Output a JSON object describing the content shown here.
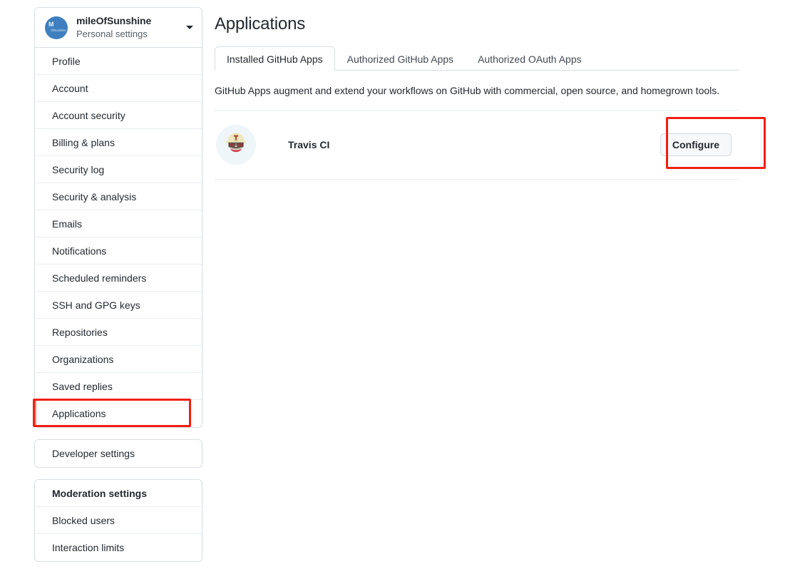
{
  "sidebar": {
    "profile": {
      "avatar_initial": "M",
      "avatar_sub": "OfSunshine",
      "name": "mileOfSunshine",
      "subtitle": "Personal settings",
      "caret_icon": "chevron-down-icon"
    },
    "groups": [
      {
        "items": [
          {
            "label": "Profile",
            "selected": false,
            "is_header": false
          },
          {
            "label": "Account",
            "selected": false,
            "is_header": false
          },
          {
            "label": "Account security",
            "selected": false,
            "is_header": false
          },
          {
            "label": "Billing & plans",
            "selected": false,
            "is_header": false
          },
          {
            "label": "Security log",
            "selected": false,
            "is_header": false
          },
          {
            "label": "Security & analysis",
            "selected": false,
            "is_header": false
          },
          {
            "label": "Emails",
            "selected": false,
            "is_header": false
          },
          {
            "label": "Notifications",
            "selected": false,
            "is_header": false
          },
          {
            "label": "Scheduled reminders",
            "selected": false,
            "is_header": false
          },
          {
            "label": "SSH and GPG keys",
            "selected": false,
            "is_header": false
          },
          {
            "label": "Repositories",
            "selected": false,
            "is_header": false
          },
          {
            "label": "Organizations",
            "selected": false,
            "is_header": false
          },
          {
            "label": "Saved replies",
            "selected": false,
            "is_header": false
          },
          {
            "label": "Applications",
            "selected": true,
            "is_header": false
          }
        ]
      },
      {
        "items": [
          {
            "label": "Developer settings",
            "selected": false,
            "is_header": false
          }
        ]
      },
      {
        "items": [
          {
            "label": "Moderation settings",
            "selected": false,
            "is_header": true
          },
          {
            "label": "Blocked users",
            "selected": false,
            "is_header": false
          },
          {
            "label": "Interaction limits",
            "selected": false,
            "is_header": false
          }
        ]
      }
    ]
  },
  "main": {
    "title": "Applications",
    "tabs": [
      {
        "label": "Installed GitHub Apps",
        "active": true
      },
      {
        "label": "Authorized GitHub Apps",
        "active": false
      },
      {
        "label": "Authorized OAuth Apps",
        "active": false
      }
    ],
    "description": "GitHub Apps augment and extend your workflows on GitHub with commercial, open source, and homegrown tools.",
    "apps": [
      {
        "name": "Travis CI",
        "logo_icon": "travis-ci-logo-icon",
        "action_label": "Configure"
      }
    ]
  },
  "annotations": {
    "color": "#f01f12",
    "boxes": [
      "applications-nav-item",
      "configure-button"
    ]
  }
}
